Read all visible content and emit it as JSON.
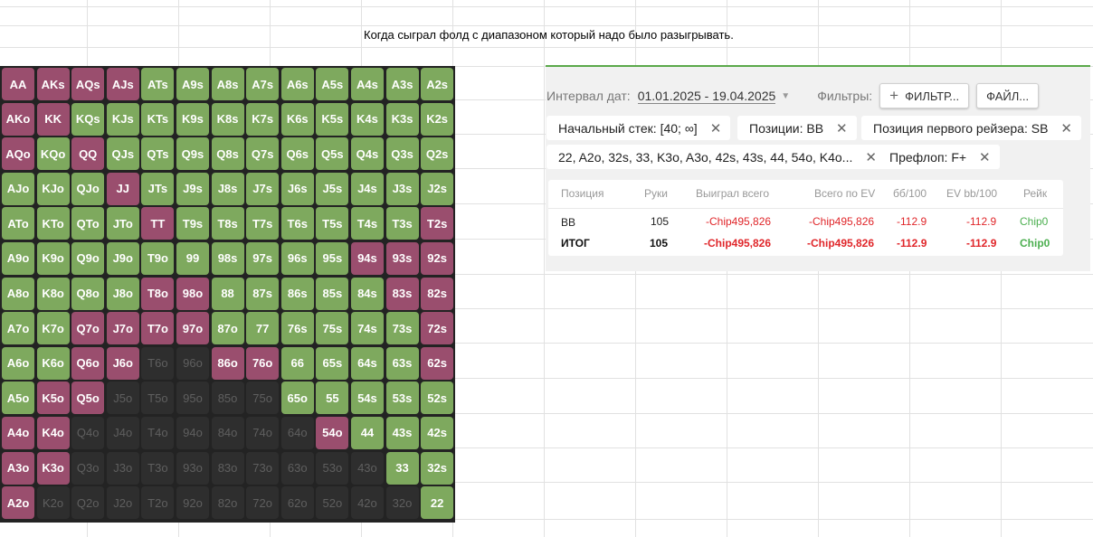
{
  "caption": "Когда сыграл фолд с диапазоном который надо было разыгрывать.",
  "colors": {
    "played": "#7ea95e",
    "folded": "#9a4e6e",
    "empty": "#2e2e2e",
    "grid_bg": "#232323"
  },
  "grid": [
    [
      "AA",
      "AKs",
      "AQs",
      "AJs",
      "ATs",
      "A9s",
      "A8s",
      "A7s",
      "A6s",
      "A5s",
      "A4s",
      "A3s",
      "A2s"
    ],
    [
      "AKo",
      "KK",
      "KQs",
      "KJs",
      "KTs",
      "K9s",
      "K8s",
      "K7s",
      "K6s",
      "K5s",
      "K4s",
      "K3s",
      "K2s"
    ],
    [
      "AQo",
      "KQo",
      "QQ",
      "QJs",
      "QTs",
      "Q9s",
      "Q8s",
      "Q7s",
      "Q6s",
      "Q5s",
      "Q4s",
      "Q3s",
      "Q2s"
    ],
    [
      "AJo",
      "KJo",
      "QJo",
      "JJ",
      "JTs",
      "J9s",
      "J8s",
      "J7s",
      "J6s",
      "J5s",
      "J4s",
      "J3s",
      "J2s"
    ],
    [
      "ATo",
      "KTo",
      "QTo",
      "JTo",
      "TT",
      "T9s",
      "T8s",
      "T7s",
      "T6s",
      "T5s",
      "T4s",
      "T3s",
      "T2s"
    ],
    [
      "A9o",
      "K9o",
      "Q9o",
      "J9o",
      "T9o",
      "99",
      "98s",
      "97s",
      "96s",
      "95s",
      "94s",
      "93s",
      "92s"
    ],
    [
      "A8o",
      "K8o",
      "Q8o",
      "J8o",
      "T8o",
      "98o",
      "88",
      "87s",
      "86s",
      "85s",
      "84s",
      "83s",
      "82s"
    ],
    [
      "A7o",
      "K7o",
      "Q7o",
      "J7o",
      "T7o",
      "97o",
      "87o",
      "77",
      "76s",
      "75s",
      "74s",
      "73s",
      "72s"
    ],
    [
      "A6o",
      "K6o",
      "Q6o",
      "J6o",
      "T6o",
      "96o",
      "86o",
      "76o",
      "66",
      "65s",
      "64s",
      "63s",
      "62s"
    ],
    [
      "A5o",
      "K5o",
      "Q5o",
      "J5o",
      "T5o",
      "95o",
      "85o",
      "75o",
      "65o",
      "55",
      "54s",
      "53s",
      "52s"
    ],
    [
      "A4o",
      "K4o",
      "Q4o",
      "J4o",
      "T4o",
      "94o",
      "84o",
      "74o",
      "64o",
      "54o",
      "44",
      "43s",
      "42s"
    ],
    [
      "A3o",
      "K3o",
      "Q3o",
      "J3o",
      "T3o",
      "93o",
      "83o",
      "73o",
      "63o",
      "53o",
      "43o",
      "33",
      "32s"
    ],
    [
      "A2o",
      "K2o",
      "Q2o",
      "J2o",
      "T2o",
      "92o",
      "82o",
      "72o",
      "62o",
      "52o",
      "42o",
      "32o",
      "22"
    ]
  ],
  "cell_state": [
    [
      "F",
      "F",
      "F",
      "F",
      "P",
      "P",
      "P",
      "P",
      "P",
      "P",
      "P",
      "P",
      "P"
    ],
    [
      "F",
      "F",
      "P",
      "P",
      "P",
      "P",
      "P",
      "P",
      "P",
      "P",
      "P",
      "P",
      "P"
    ],
    [
      "F",
      "P",
      "F",
      "P",
      "P",
      "P",
      "P",
      "P",
      "P",
      "P",
      "P",
      "P",
      "P"
    ],
    [
      "P",
      "P",
      "P",
      "F",
      "P",
      "P",
      "P",
      "P",
      "P",
      "P",
      "P",
      "P",
      "P"
    ],
    [
      "P",
      "P",
      "P",
      "P",
      "F",
      "P",
      "P",
      "P",
      "P",
      "P",
      "P",
      "P",
      "F"
    ],
    [
      "P",
      "P",
      "P",
      "P",
      "P",
      "P",
      "P",
      "P",
      "P",
      "P",
      "F",
      "F",
      "F"
    ],
    [
      "P",
      "P",
      "P",
      "P",
      "F",
      "F",
      "P",
      "P",
      "P",
      "P",
      "P",
      "F",
      "F"
    ],
    [
      "P",
      "P",
      "F",
      "F",
      "F",
      "F",
      "P",
      "P",
      "P",
      "P",
      "P",
      "P",
      "F"
    ],
    [
      "P",
      "P",
      "F",
      "F",
      "E",
      "E",
      "F",
      "F",
      "P",
      "P",
      "P",
      "P",
      "F"
    ],
    [
      "P",
      "F",
      "F",
      "E",
      "E",
      "E",
      "E",
      "E",
      "P",
      "P",
      "P",
      "P",
      "P"
    ],
    [
      "F",
      "F",
      "E",
      "E",
      "E",
      "E",
      "E",
      "E",
      "E",
      "F",
      "P",
      "P",
      "P"
    ],
    [
      "F",
      "F",
      "E",
      "E",
      "E",
      "E",
      "E",
      "E",
      "E",
      "E",
      "E",
      "P",
      "P"
    ],
    [
      "F",
      "E",
      "E",
      "E",
      "E",
      "E",
      "E",
      "E",
      "E",
      "E",
      "E",
      "E",
      "P"
    ]
  ],
  "panel": {
    "interval_label": "Интервал дат:",
    "interval_value": "01.01.2025 - 19.04.2025",
    "filters_label": "Фильтры:",
    "add_filter": "ФИЛЬТР...",
    "file_button": "ФАЙЛ...",
    "chips": [
      "Начальный стек: [40; ∞]",
      "Позиции: BB",
      "Позиция первого рейзера: SB",
      "22, A2o, 32s, 33, K3o, A3o, 42s, 43s, 44, 54o, K4o...",
      "Префлоп: F+"
    ],
    "table": {
      "headers": [
        "Позиция",
        "Руки",
        "Выиграл всего",
        "Всего по EV",
        "бб/100",
        "EV bb/100",
        "Рейк"
      ],
      "rows": [
        [
          "BB",
          "105",
          "-Chip495,826",
          "-Chip495,826",
          "-112.9",
          "-112.9",
          "Chip0"
        ],
        [
          "ИТОГ",
          "105",
          "-Chip495,826",
          "-Chip495,826",
          "-112.9",
          "-112.9",
          "Chip0"
        ]
      ]
    }
  }
}
